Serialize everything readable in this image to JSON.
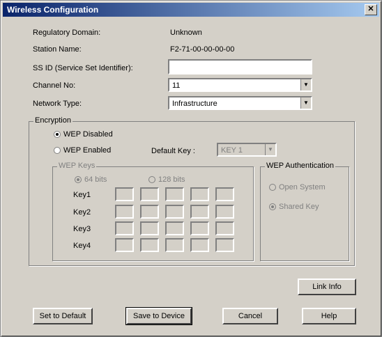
{
  "window": {
    "title": "Wireless Configuration",
    "close_glyph": "✕"
  },
  "info": {
    "regulatory_label": "Regulatory Domain:",
    "regulatory_value": "Unknown",
    "station_label": "Station Name:",
    "station_value": "F2-71-00-00-00-00"
  },
  "form": {
    "ssid_label": "SS ID (Service Set Identifier):",
    "ssid_value": "",
    "channel_label": "Channel No:",
    "channel_value": "11",
    "network_label": "Network Type:",
    "network_value": "Infrastructure"
  },
  "encryption": {
    "legend": "Encryption",
    "wep_disabled": "WEP Disabled",
    "wep_enabled": "WEP Enabled",
    "default_key_label": "Default Key :",
    "default_key_value": "KEY 1",
    "wep_keys_legend": "WEP Keys",
    "bits64": "64 bits",
    "bits128": "128 bits",
    "key_labels": [
      "Key1",
      "Key2",
      "Key3",
      "Key4"
    ],
    "auth_legend": "WEP Authentication",
    "open_system": "Open System",
    "shared_key": "Shared Key"
  },
  "buttons": {
    "link_info": "Link Info",
    "set_default": "Set to Default",
    "save_device": "Save to Device",
    "cancel": "Cancel",
    "help": "Help"
  },
  "colors": {
    "face": "#d4d0c8",
    "title_start": "#0a246a",
    "title_end": "#a6caf0"
  }
}
